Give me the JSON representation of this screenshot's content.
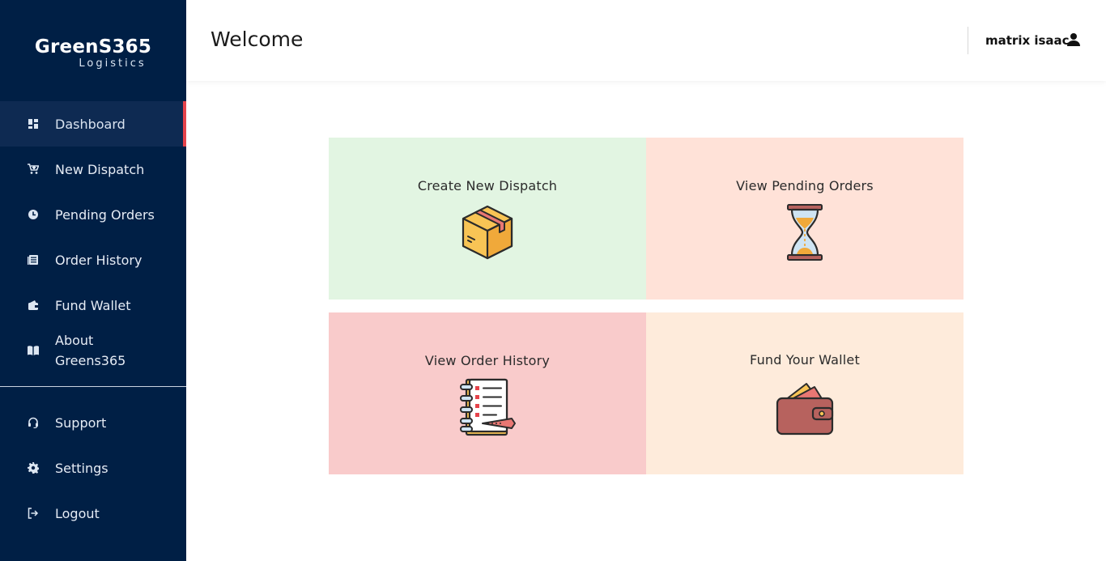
{
  "brand": {
    "name_part1": "Green",
    "name_part2": "S365",
    "tagline": "Logistics"
  },
  "sidebar": {
    "items": [
      {
        "label": "Dashboard",
        "icon": "dashboard-icon",
        "active": true
      },
      {
        "label": "New Dispatch",
        "icon": "cart-icon"
      },
      {
        "label": "Pending Orders",
        "icon": "clock-icon"
      },
      {
        "label": "Order History",
        "icon": "list-icon"
      },
      {
        "label": "Fund Wallet",
        "icon": "wallet-icon"
      },
      {
        "label": "About Greens365",
        "icon": "book-icon"
      }
    ],
    "bottom_items": [
      {
        "label": "Support",
        "icon": "headset-icon"
      },
      {
        "label": "Settings",
        "icon": "gear-icon"
      },
      {
        "label": "Logout",
        "icon": "logout-icon"
      }
    ]
  },
  "header": {
    "title": "Welcome",
    "user_name": "matrix isaac",
    "user_icon": "user-icon"
  },
  "tiles": [
    {
      "label": "Create New Dispatch",
      "icon": "package-box-icon",
      "bg": "#e2f5e2"
    },
    {
      "label": "View Pending Orders",
      "icon": "hourglass-icon",
      "bg": "#ffe2d8"
    },
    {
      "label": "View Order History",
      "icon": "notebook-list-icon",
      "bg": "#f9cbcb"
    },
    {
      "label": "Fund Your Wallet",
      "icon": "wallet-cards-icon",
      "bg": "#feebdb"
    }
  ],
  "colors": {
    "sidebar_bg": "#001f45",
    "active_indicator": "#e5434b"
  }
}
